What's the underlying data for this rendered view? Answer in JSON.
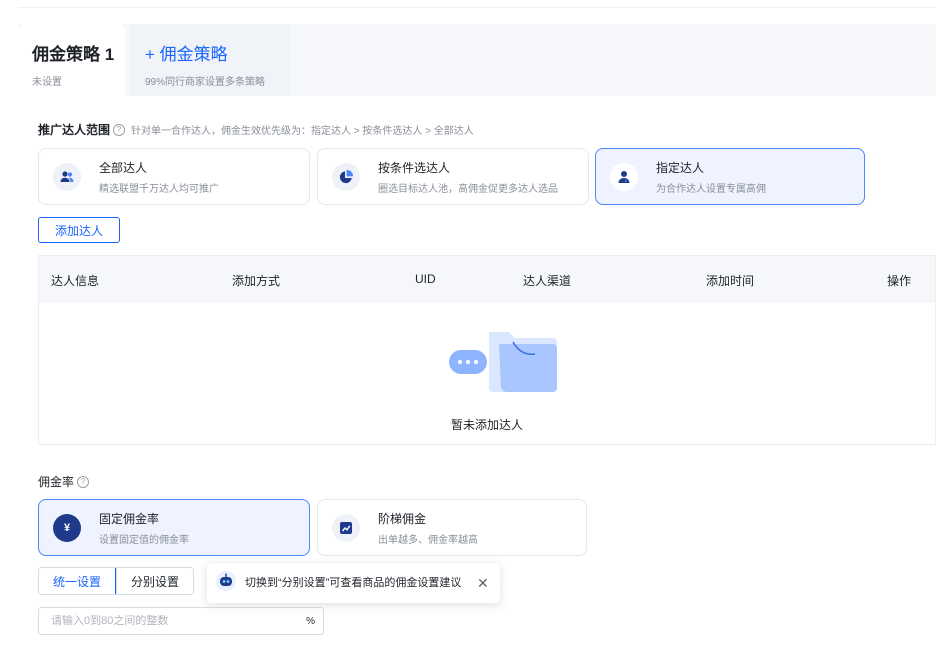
{
  "tabs": [
    {
      "title": "佣金策略 1",
      "subtitle": "未设置"
    },
    {
      "title": "+ 佣金策略",
      "subtitle": "99%同行商家设置多条策略"
    }
  ],
  "scope": {
    "label": "推广达人范围",
    "hint": "针对单一合作达人，佣金生效优先级为：指定达人 > 按条件选达人 > 全部达人",
    "options": [
      {
        "title": "全部达人",
        "desc": "精选联盟千万达人均可推广",
        "icon": "users-icon"
      },
      {
        "title": "按条件选达人",
        "desc": "圈选目标达人池，高佣金促更多达人选品",
        "icon": "pie-chart-icon"
      },
      {
        "title": "指定达人",
        "desc": "为合作达人设置专属高佣",
        "icon": "user-icon",
        "selected": true
      }
    ],
    "add_button": "添加达人"
  },
  "table": {
    "headers": [
      "达人信息",
      "添加方式",
      "UID",
      "达人渠道",
      "添加时间",
      "操作"
    ],
    "empty_text": "暂未添加达人"
  },
  "commission": {
    "label": "佣金率",
    "options": [
      {
        "title": "固定佣金率",
        "desc": "设置固定值的佣金率",
        "icon": "yen-icon",
        "selected": true
      },
      {
        "title": "阶梯佣金",
        "desc": "出单越多、佣金率越高",
        "icon": "trend-chart-icon"
      }
    ],
    "segments": [
      "统一设置",
      "分别设置"
    ],
    "tooltip": "切换到“分别设置”可查看商品的佣金设置建议",
    "input_placeholder": "请输入0到80之间的整数",
    "input_suffix": "%"
  },
  "colors": {
    "accent": "#1966ff",
    "selected_bg": "#eef3ff",
    "selected_border": "#4a86ff"
  }
}
